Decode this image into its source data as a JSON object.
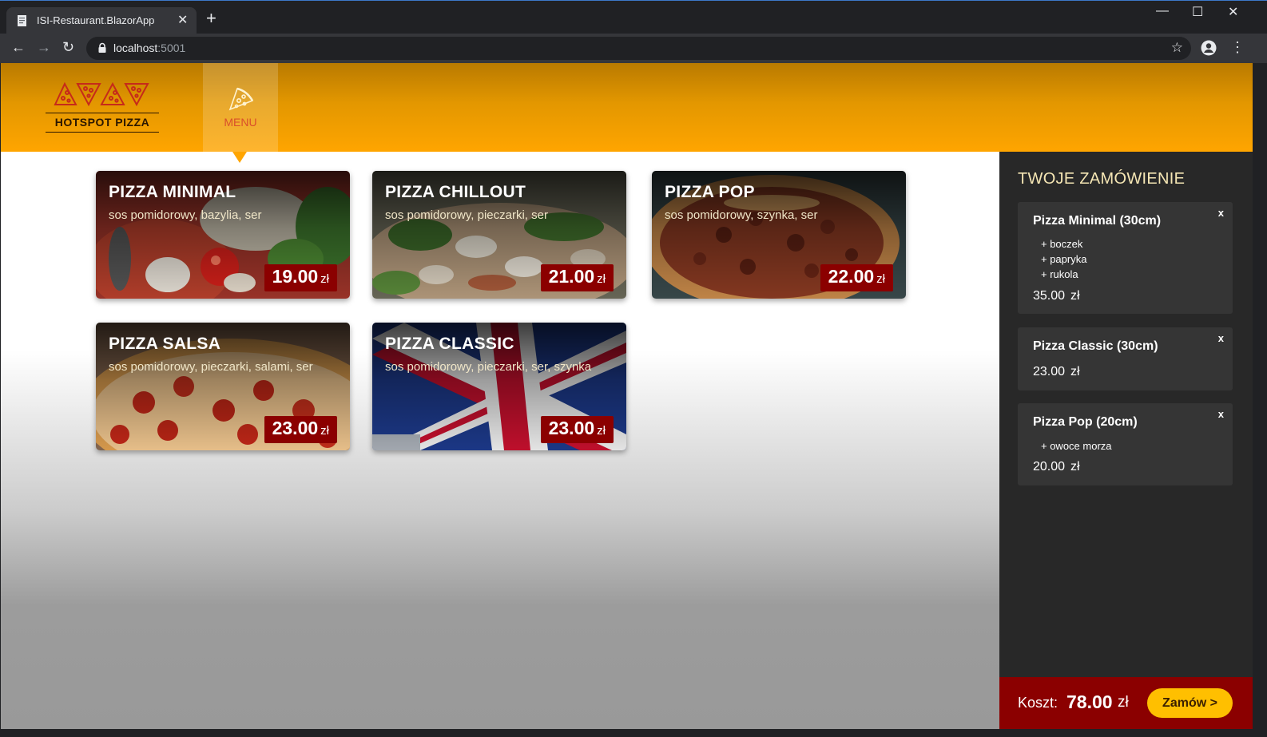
{
  "browser": {
    "tab_title": "ISI-Restaurant.BlazorApp",
    "url_host": "localhost",
    "url_port": ":5001"
  },
  "header": {
    "brand": "HOTSPOT PIZZA",
    "menu_label": "MENU",
    "accent_color": "#ffa500"
  },
  "menu": {
    "items": [
      {
        "name": "PIZZA MINIMAL",
        "desc": "sos pomidorowy, bazylia, ser",
        "price": "19.00",
        "currency": "zł"
      },
      {
        "name": "PIZZA CHILLOUT",
        "desc": "sos pomidorowy, pieczarki, ser",
        "price": "21.00",
        "currency": "zł"
      },
      {
        "name": "PIZZA POP",
        "desc": "sos pomidorowy, szynka, ser",
        "price": "22.00",
        "currency": "zł"
      },
      {
        "name": "PIZZA SALSA",
        "desc": "sos pomidorowy, pieczarki, salami, ser",
        "price": "23.00",
        "currency": "zł"
      },
      {
        "name": "PIZZA CLASSIC",
        "desc": "sos pomidorowy, pieczarki, ser, szynka",
        "price": "23.00",
        "currency": "zł"
      }
    ]
  },
  "order": {
    "title": "TWOJE ZAMÓWIENIE",
    "remove_label": "x",
    "items": [
      {
        "name": "Pizza Minimal (30cm)",
        "extras": [
          "+ boczek",
          "+ papryka",
          "+ rukola"
        ],
        "price": "35.00",
        "currency": "zł"
      },
      {
        "name": "Pizza Classic (30cm)",
        "extras": [],
        "price": "23.00",
        "currency": "zł"
      },
      {
        "name": "Pizza Pop (20cm)",
        "extras": [
          "+ owoce morza"
        ],
        "price": "20.00",
        "currency": "zł"
      }
    ],
    "cost_label": "Koszt:",
    "total": "78.00",
    "currency": "zł",
    "submit_label": "Zamów >"
  }
}
